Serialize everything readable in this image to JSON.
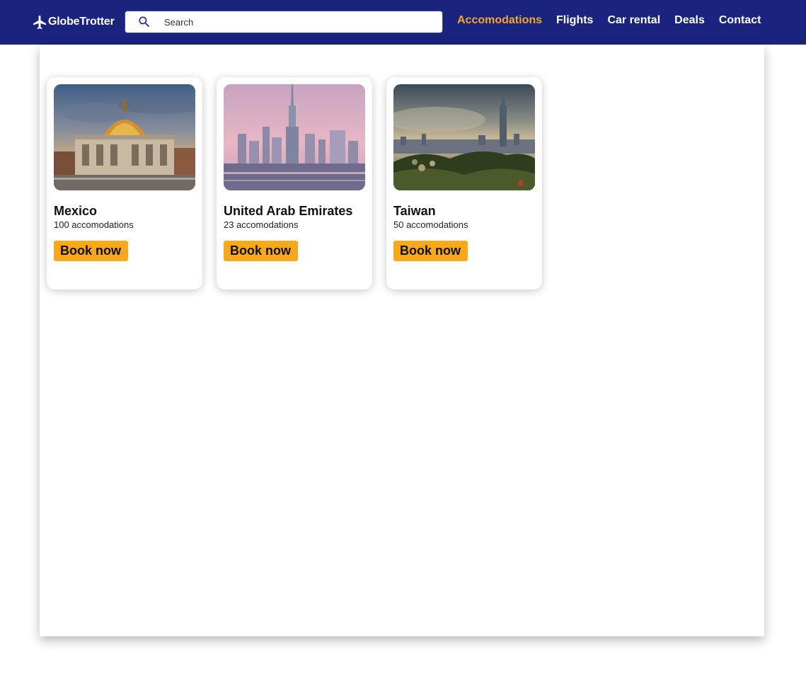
{
  "brand": {
    "name": "GlobeTrotter",
    "icon": "airplane-icon"
  },
  "search": {
    "placeholder": "Search",
    "value": "",
    "icon": "search-icon"
  },
  "nav": {
    "items": [
      {
        "label": "Accomodations",
        "active": true
      },
      {
        "label": "Flights",
        "active": false
      },
      {
        "label": "Car rental",
        "active": false
      },
      {
        "label": "Deals",
        "active": false
      },
      {
        "label": "Contact",
        "active": false
      }
    ]
  },
  "colors": {
    "navbar": "#1a237e",
    "accent": "#f6a627",
    "button": "#f7a81b"
  },
  "destinations": [
    {
      "name": "Mexico",
      "count": "100 accomodations",
      "cta": "Book now",
      "image": "palacio-de-bellas-artes-photo"
    },
    {
      "name": "United Arab Emirates",
      "count": "23 accomodations",
      "cta": "Book now",
      "image": "dubai-skyline-photo"
    },
    {
      "name": "Taiwan",
      "count": "50 accomodations",
      "cta": "Book now",
      "image": "taipei-skyline-photo"
    }
  ]
}
